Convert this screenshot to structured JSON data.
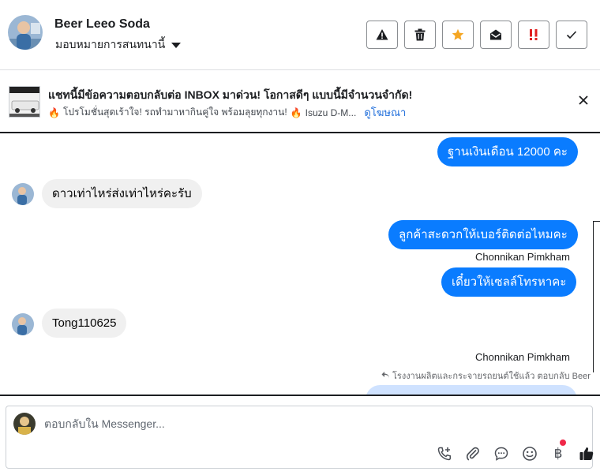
{
  "header": {
    "contact_name": "Beer Leeo Soda",
    "assign_label": "มอบหมายการสนทนานี้",
    "actions": [
      {
        "name": "report-spam-button",
        "icon": "warning-icon",
        "color": "#1c1e21"
      },
      {
        "name": "delete-button",
        "icon": "trash-icon",
        "color": "#1c1e21"
      },
      {
        "name": "star-button",
        "icon": "star-icon",
        "color": "#f5a623"
      },
      {
        "name": "mark-unread-button",
        "icon": "envelope-open-icon",
        "color": "#1c1e21"
      },
      {
        "name": "priority-button",
        "icon": "double-exclamation-icon",
        "color": "#e02020"
      },
      {
        "name": "mark-done-button",
        "icon": "check-icon",
        "color": "#1c1e21"
      }
    ]
  },
  "ad": {
    "title": "แชทนี้มีข้อความตอบกลับต่อ INBOX มาด่วน! โอกาสดีๆ แบบนี้มีจำนวนจำกัด!",
    "subtitle_1": "โปรโมชั่นสุดเร้าใจ! รถทำมาหากินคู่ใจ พร้อมลุยทุกงาน!",
    "subtitle_2": "Isuzu D-M...",
    "link": "ดูโฆษณา"
  },
  "messages": [
    {
      "direction": "out",
      "text": "ฐานเงินเดือน 12000 คะ"
    },
    {
      "direction": "in",
      "text": "ดาวเท่าไหร่ส่งเท่าไหร่คะรับ"
    },
    {
      "direction": "out",
      "text": "ลูกค้าสะดวกให้เบอร์ติดต่อไหมคะ"
    },
    {
      "direction": "sender",
      "text": "Chonnikan Pimkham"
    },
    {
      "direction": "out",
      "text": "เดี๋ยวให้เซลล์โทรหาคะ"
    },
    {
      "direction": "in",
      "text": "Tong110625"
    },
    {
      "direction": "sender",
      "text": "Chonnikan Pimkham"
    },
    {
      "direction": "note",
      "text": "โรงงานผลิตและกระจายรถยนต์ใช้แล้ว ตอบกลับ Beer"
    }
  ],
  "composer": {
    "placeholder": "ตอบกลับใน Messenger...",
    "tools": [
      "call-plus-icon",
      "paperclip-icon",
      "chat-bubble-icon",
      "smiley-icon",
      "baht-icon",
      "thumbs-up-icon"
    ],
    "baht_symbol": "฿"
  },
  "colors": {
    "outgoing_bubble": "#0a7cff",
    "incoming_bubble": "#f0f0f0",
    "link": "#216fdb",
    "notification_dot": "#f02849"
  }
}
